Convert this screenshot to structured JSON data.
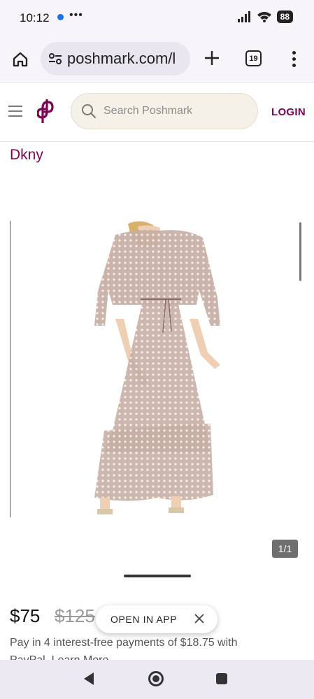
{
  "status_bar": {
    "time": "10:12",
    "more": "•••",
    "battery": "88"
  },
  "browser": {
    "url": "poshmark.com/l",
    "tab_count": "19"
  },
  "header": {
    "search_placeholder": "Search Poshmark",
    "login_label": "LOGIN",
    "brand_color": "#7f0353"
  },
  "listing": {
    "brand": "Dkny",
    "image_counter": "1/1",
    "price": "$75",
    "original_price": "$125",
    "installments_text": "Pay in 4 interest-free payments of $18.75 with",
    "installments_line2": "PayPal. Learn More"
  },
  "open_app": {
    "label": "OPEN IN APP"
  },
  "icons": {
    "home": "home-icon",
    "tune": "tune-icon",
    "add": "plus-icon",
    "tabs": "tabs-icon",
    "menu": "more-vert-icon",
    "hamburger": "hamburger-icon",
    "search": "search-icon",
    "close": "close-icon",
    "nav_back": "back-icon",
    "nav_home": "home-circle-icon",
    "nav_recent": "recent-apps-icon"
  }
}
